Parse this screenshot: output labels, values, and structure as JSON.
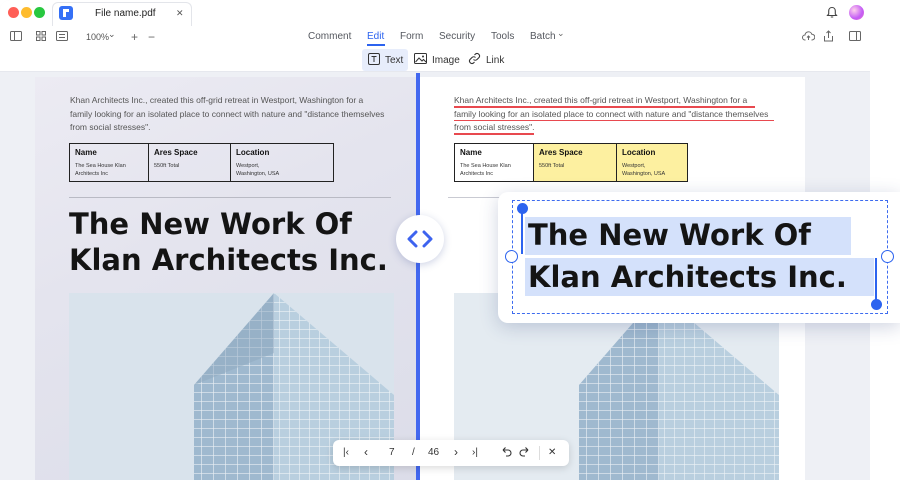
{
  "titlebar": {
    "tab_title": "File name.pdf",
    "close_glyph": "✕",
    "window_dots": [
      "#ff5f57",
      "#febc2e",
      "#28c840"
    ]
  },
  "toolbar": {
    "zoom": "100%",
    "zoom_caret": "⌄",
    "zoom_in": "+",
    "zoom_out": "−",
    "menus": [
      "Comment",
      "Edit",
      "Form",
      "Security",
      "Tools",
      "Batch"
    ],
    "batch_caret": "⌄",
    "active_menu": "Edit",
    "accent": "#2c63ef"
  },
  "edit_tools": {
    "text": "Text",
    "image": "Image",
    "link": "Link"
  },
  "document": {
    "intro": "Khan Architects Inc., created this off-grid retreat in Westport, Washington for a family looking for an isolated place to connect with nature and \"distance themselves from social stresses\".",
    "intro_lines": [
      "Khan Architects Inc., created this off-grid retreat in Westport, Washington for a",
      "family looking for an isolated place to connect with nature and \"distance themselves",
      "from social stresses\"."
    ],
    "table": [
      {
        "header": "Name",
        "lines": [
          "The Sea House Klan",
          "Architects Inc"
        ]
      },
      {
        "header": "Ares Space",
        "lines": [
          "550ft Total"
        ]
      },
      {
        "header": "Location",
        "lines": [
          "Westport,",
          "Washington, USA"
        ]
      }
    ],
    "headline_lines": [
      "The New Work Of",
      "Klan Architects Inc."
    ],
    "highlight_color": "#fdf0a0",
    "underline_color": "#e8494f"
  },
  "pager": {
    "current": "7",
    "separator": "/",
    "total": "46",
    "first": "|‹",
    "prev": "‹",
    "next": "›",
    "last": "›|",
    "close": "✕"
  }
}
